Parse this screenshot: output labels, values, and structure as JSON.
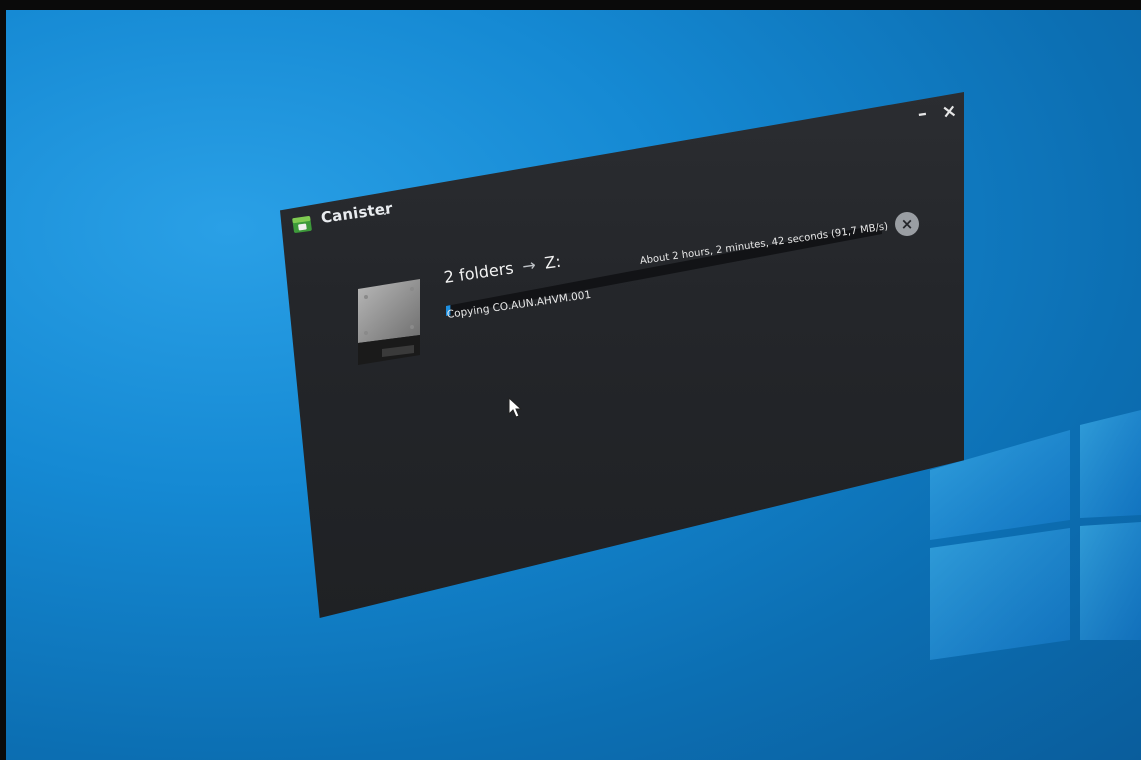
{
  "window": {
    "app_name": "Canister",
    "title_caret": "⌄",
    "minimize_label": "–",
    "close_label": "×"
  },
  "job": {
    "source": "2 folders",
    "arrow": "→",
    "destination": "Z:",
    "status": "Copying CO.AUN.AHVM.001",
    "eta": "About 2 hours, 2 minutes, 42 seconds (91,7 MB/s)",
    "progress": 0.01,
    "cancel_label": "×"
  },
  "icons": {
    "app": "canister-app-icon",
    "drive": "hard-drive-icon",
    "cursor": "mouse-pointer-icon"
  },
  "colors": {
    "accent": "#1e8fe0",
    "window_bg": "#24262a",
    "desktop": "#1589d3"
  }
}
